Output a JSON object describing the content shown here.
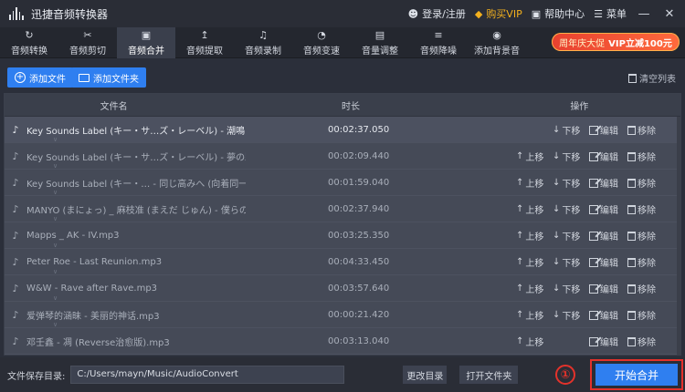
{
  "app": {
    "title": "迅捷音频转换器",
    "login": "登录/注册",
    "vip": "购买VIP",
    "help": "帮助中心",
    "menu": "菜单"
  },
  "tabs": [
    {
      "label": "音频转换",
      "icon": "convert-icon"
    },
    {
      "label": "音频剪切",
      "icon": "scissors-icon"
    },
    {
      "label": "音频合并",
      "icon": "merge-icon",
      "active": true
    },
    {
      "label": "音频提取",
      "icon": "extract-icon"
    },
    {
      "label": "音频录制",
      "icon": "microphone-icon"
    },
    {
      "label": "音频变速",
      "icon": "speed-icon"
    },
    {
      "label": "音量调整",
      "icon": "volume-icon"
    },
    {
      "label": "音频降噪",
      "icon": "denoise-icon"
    },
    {
      "label": "添加背景音",
      "icon": "music-disc-icon"
    }
  ],
  "promo": {
    "text": "周年庆大促",
    "highlight": "VIP立减100元"
  },
  "toolbar": {
    "add_file": "添加文件",
    "add_folder": "添加文件夹",
    "clear_list": "清空列表"
  },
  "table": {
    "headers": {
      "name": "文件名",
      "duration": "时长",
      "ops": "操作"
    },
    "op_labels": {
      "up": "上移",
      "down": "下移",
      "edit": "编辑",
      "delete": "移除"
    },
    "rows": [
      {
        "name": "Key Sounds Label (キー・サ…ズ・レーベル) - 潮鳴り",
        "duration": "00:02:37.050"
      },
      {
        "name": "Key Sounds Label (キー・サ…ズ・レーベル) - 夢の跡",
        "duration": "00:02:09.440"
      },
      {
        "name": "Key Sounds Label (キー・… - 同じ高みへ (向着同一高",
        "duration": "00:01:59.040"
      },
      {
        "name": "MANYO (まにょっ) _ 麻枝准 (まえだ じゅん) - 僕らの…",
        "duration": "00:02:37.940"
      },
      {
        "name": "Mapps _ AK - IV.mp3",
        "duration": "00:03:25.350"
      },
      {
        "name": "Peter Roe - Last Reunion.mp3",
        "duration": "00:04:33.450"
      },
      {
        "name": "W&W - Rave after Rave.mp3",
        "duration": "00:03:57.640"
      },
      {
        "name": "爱弹琴的涵昧 - 美丽的神话.mp3",
        "duration": "00:00:21.420"
      },
      {
        "name": "邓壬鑫 - 凋 (Reverse治愈版).mp3",
        "duration": "00:03:13.040"
      }
    ]
  },
  "footer": {
    "save_label": "文件保存目录:",
    "save_path": "C:/Users/mayn/Music/AudioConvert",
    "change_dir": "更改目录",
    "open_folder": "打开文件夹",
    "step_badge": "①",
    "start": "开始合并"
  }
}
